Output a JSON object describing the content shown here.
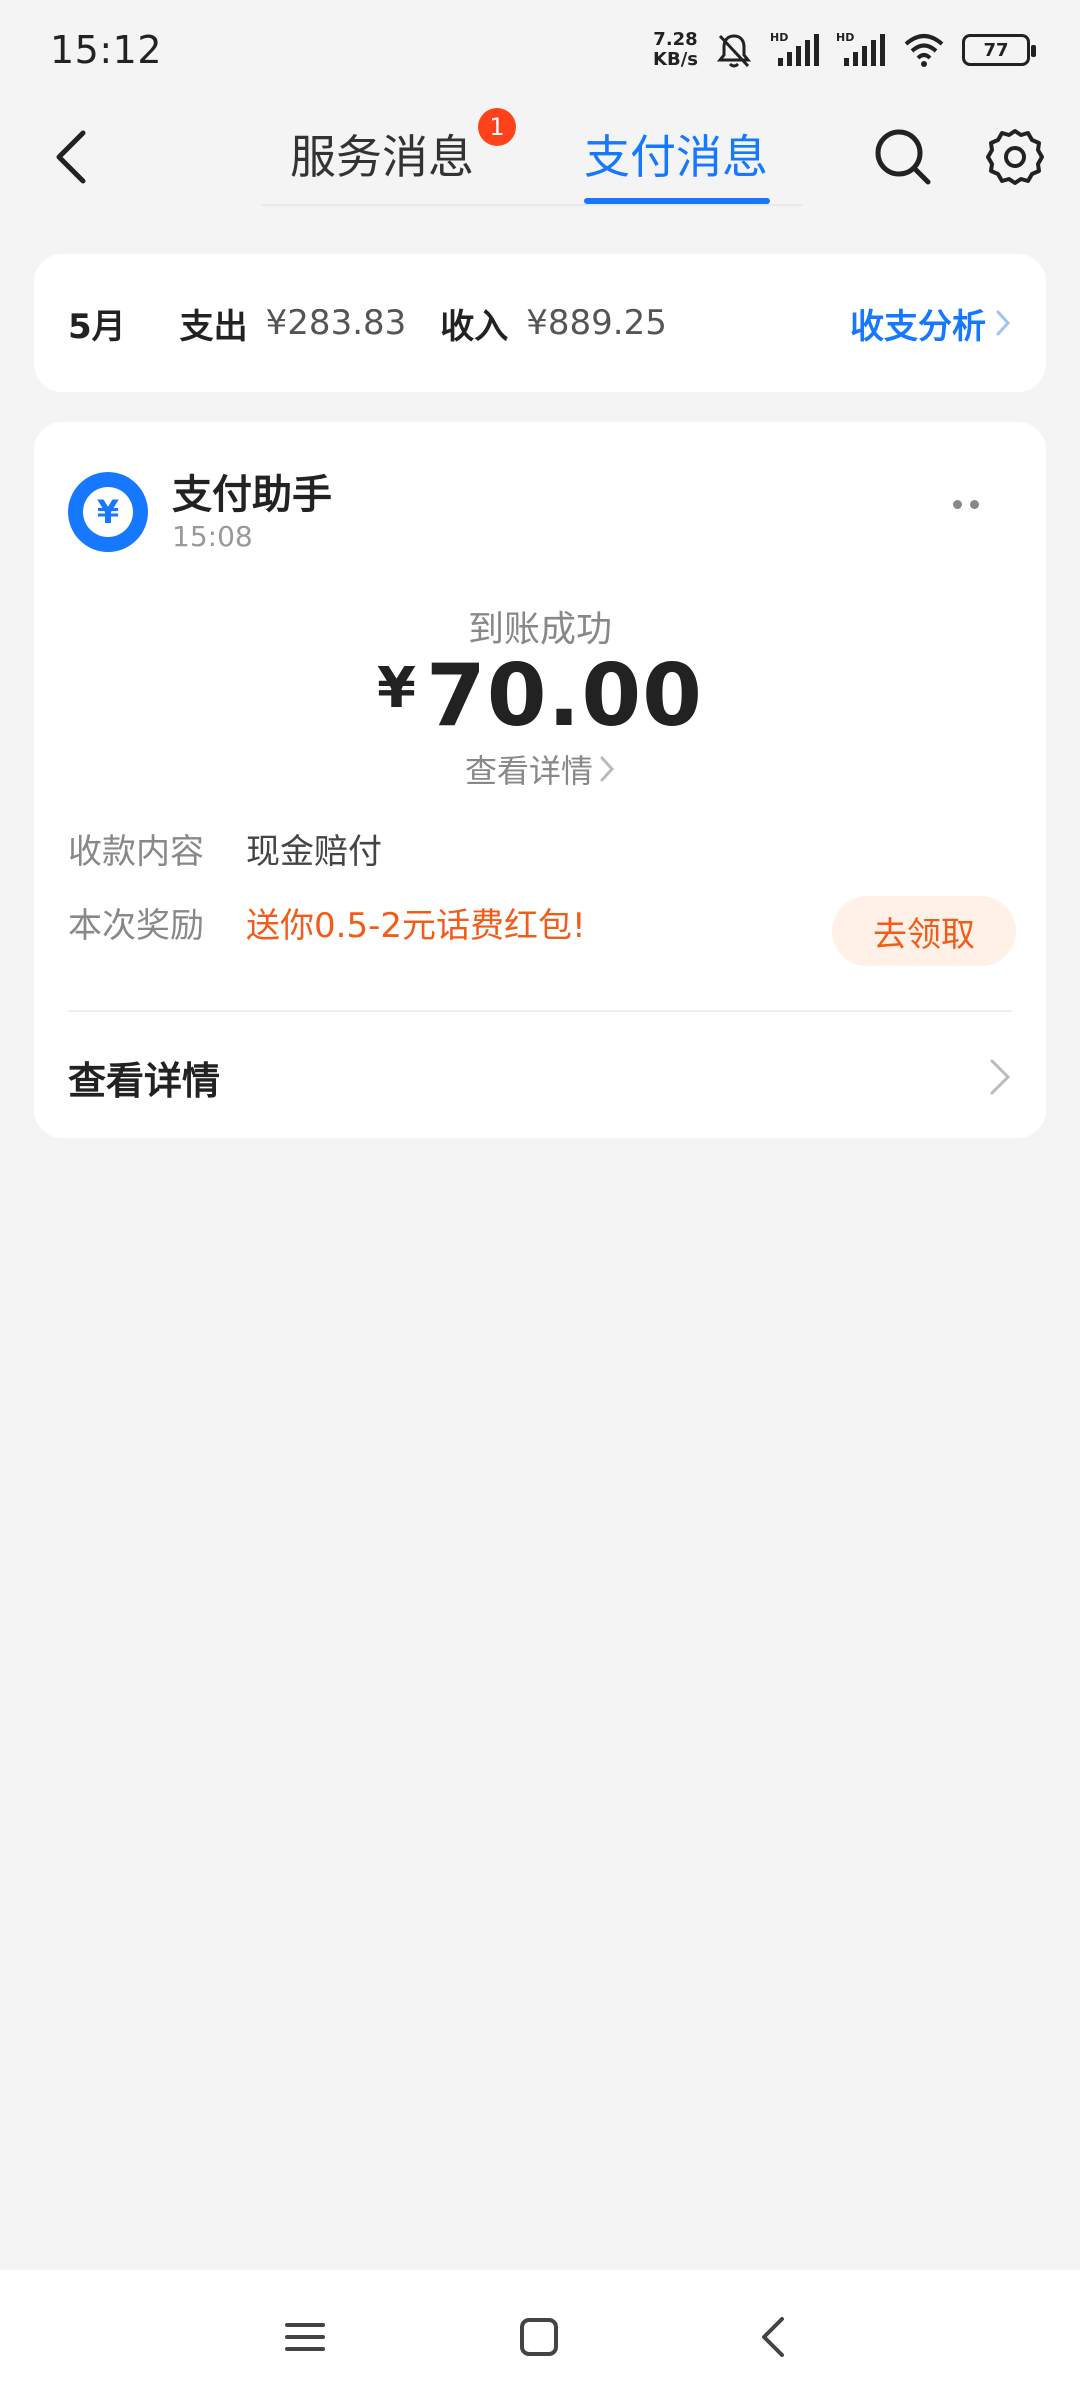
{
  "status_bar": {
    "time": "15:12",
    "net_speed_value": "7.28",
    "net_speed_unit": "KB/s",
    "battery": "77",
    "icons": [
      "mute-bell-icon",
      "hd-signal-icon",
      "hd-signal-icon",
      "wifi-icon",
      "battery-icon"
    ]
  },
  "nav": {
    "tabs": [
      {
        "label": "服务消息",
        "badge": "1"
      },
      {
        "label": "支付消息",
        "active": true
      }
    ],
    "accent_color": "#1677ff",
    "badge_color": "#ff411c"
  },
  "summary": {
    "month": "5月",
    "expense_label": "支出",
    "expense_value": "¥283.83",
    "income_label": "收入",
    "income_value": "¥889.25",
    "analysis_label": "收支分析"
  },
  "message": {
    "sender": "支付助手",
    "time": "15:08",
    "status": "到账成功",
    "currency": "¥",
    "amount": "70.00",
    "view_detail_small": "查看详情",
    "fields": [
      {
        "label": "收款内容",
        "value": "现金赔付"
      },
      {
        "label": "本次奖励",
        "value": "送你0.5-2元话费红包!"
      }
    ],
    "claim_label": "去领取",
    "view_detail": "查看详情",
    "highlight_color": "#f25c19"
  }
}
